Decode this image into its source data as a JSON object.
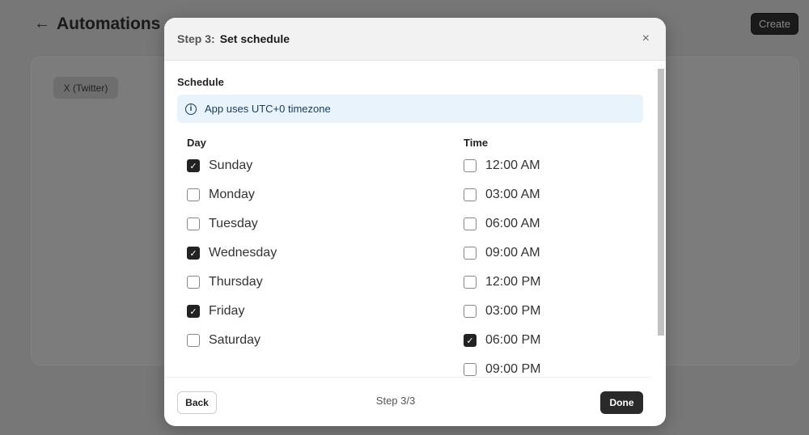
{
  "page": {
    "title": "Automations",
    "create_label": "Create",
    "chip": "X (Twitter)"
  },
  "modal": {
    "step": "Step 3:",
    "title": "Set schedule",
    "close": "×",
    "section": "Schedule",
    "info": "App uses UTC+0 timezone",
    "day_header": "Day",
    "time_header": "Time",
    "days": [
      {
        "label": "Sunday",
        "checked": true
      },
      {
        "label": "Monday",
        "checked": false
      },
      {
        "label": "Tuesday",
        "checked": false
      },
      {
        "label": "Wednesday",
        "checked": true
      },
      {
        "label": "Thursday",
        "checked": false
      },
      {
        "label": "Friday",
        "checked": true
      },
      {
        "label": "Saturday",
        "checked": false
      }
    ],
    "times": [
      {
        "label": "12:00 AM",
        "checked": false
      },
      {
        "label": "03:00 AM",
        "checked": false
      },
      {
        "label": "06:00 AM",
        "checked": false
      },
      {
        "label": "09:00 AM",
        "checked": false
      },
      {
        "label": "12:00 PM",
        "checked": false
      },
      {
        "label": "03:00 PM",
        "checked": false
      },
      {
        "label": "06:00 PM",
        "checked": true
      },
      {
        "label": "09:00 PM",
        "checked": false
      }
    ],
    "footer": {
      "back": "Back",
      "step_count": "Step 3/3",
      "done": "Done"
    }
  }
}
